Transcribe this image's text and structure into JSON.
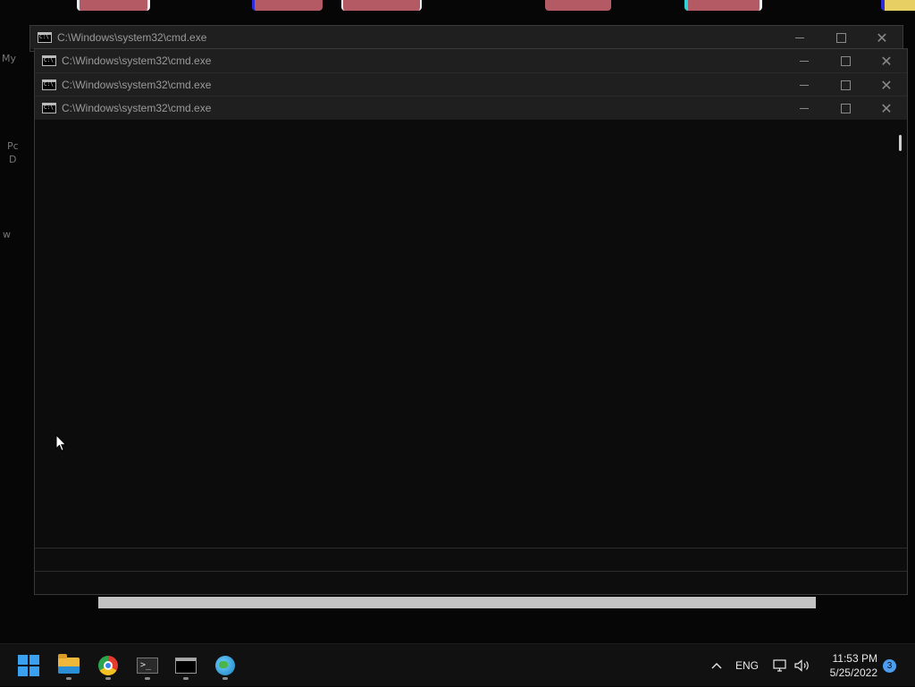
{
  "desktop": {
    "icon_label_1": "My",
    "icon_label_2": "Pc",
    "icon_label_3": "D",
    "icon_label_4": "w"
  },
  "windows": [
    {
      "title": "C:\\Windows\\system32\\cmd.exe"
    },
    {
      "title": "C:\\Windows\\system32\\cmd.exe"
    },
    {
      "title": "C:\\Windows\\system32\\cmd.exe"
    },
    {
      "title": "C:\\Windows\\system32\\cmd.exe"
    }
  ],
  "window_controls": {
    "minimize": "minimize",
    "maximize": "maximize",
    "close": "close"
  },
  "taskbar": {
    "apps": [
      {
        "name": "start",
        "icon": "windows-logo-icon"
      },
      {
        "name": "file-explorer",
        "icon": "folder-icon"
      },
      {
        "name": "chrome",
        "icon": "chrome-icon"
      },
      {
        "name": "terminal",
        "icon": "terminal-icon"
      },
      {
        "name": "command-prompt",
        "icon": "cmd-icon"
      },
      {
        "name": "browser",
        "icon": "globe-icon"
      }
    ],
    "tray": {
      "language": "ENG",
      "time": "11:53 PM",
      "date": "5/25/2022",
      "notification_count": "3"
    }
  },
  "colors": {
    "taskbar_bg": "#111111",
    "console_bg": "#0c0c0c",
    "accent": "#3aa0f0"
  }
}
